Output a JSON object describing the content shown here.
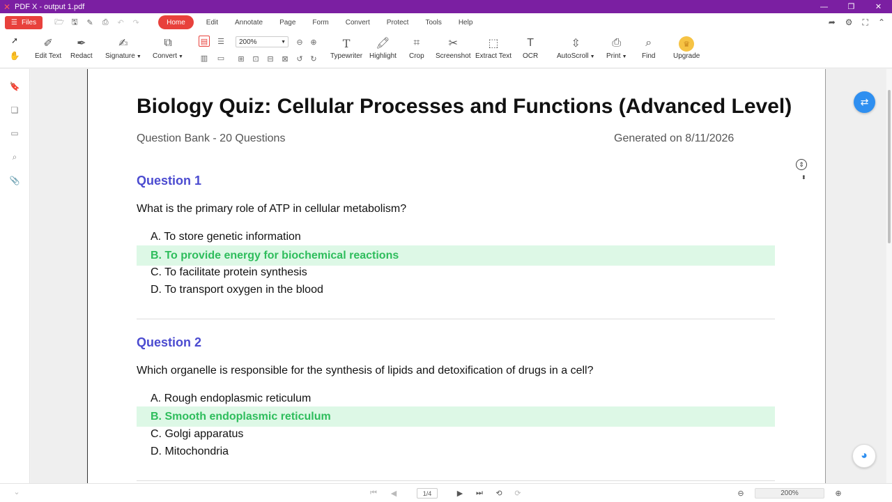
{
  "window": {
    "title": "PDF X - output 1.pdf"
  },
  "menubar": {
    "files_label": "Files",
    "items": [
      {
        "label": "Home"
      },
      {
        "label": "Edit"
      },
      {
        "label": "Annotate"
      },
      {
        "label": "Page"
      },
      {
        "label": "Form"
      },
      {
        "label": "Convert"
      },
      {
        "label": "Protect"
      },
      {
        "label": "Tools"
      },
      {
        "label": "Help"
      }
    ]
  },
  "toolbar": {
    "zoom_value": "200%",
    "edit_text": "Edit Text",
    "redact": "Redact",
    "signature": "Signature",
    "convert": "Convert",
    "typewriter": "Typewriter",
    "highlight": "Highlight",
    "crop": "Crop",
    "screenshot": "Screenshot",
    "extract_text": "Extract Text",
    "ocr": "OCR",
    "autoscroll": "AutoScroll",
    "print": "Print",
    "find": "Find",
    "upgrade": "Upgrade"
  },
  "document": {
    "title": "Biology Quiz: Cellular Processes and Functions (Advanced Level)",
    "subtitle": "Question Bank - 20 Questions",
    "generated": "Generated on 8/11/2026",
    "questions": [
      {
        "heading": "Question 1",
        "text": "What is the primary role of ATP in cellular metabolism?",
        "options": [
          "A. To store genetic information",
          "B. To provide energy for biochemical reactions",
          "C. To facilitate protein synthesis",
          "D. To transport oxygen in the blood"
        ],
        "correct_index": 1
      },
      {
        "heading": "Question 2",
        "text": "Which organelle is responsible for the synthesis of lipids and detoxification of drugs in a cell?",
        "options": [
          "A. Rough endoplasmic reticulum",
          "B. Smooth endoplasmic reticulum",
          "C. Golgi apparatus",
          "D. Mitochondria"
        ],
        "correct_index": 1
      }
    ]
  },
  "statusbar": {
    "page_indicator": "1/4",
    "zoom_value": "200%"
  },
  "colors": {
    "titlebar": "#7b1fa2",
    "accent": "#e8413c",
    "question_heading": "#4b4bd0",
    "correct_text": "#2ebd5c",
    "correct_bg": "#ddf8e6"
  }
}
